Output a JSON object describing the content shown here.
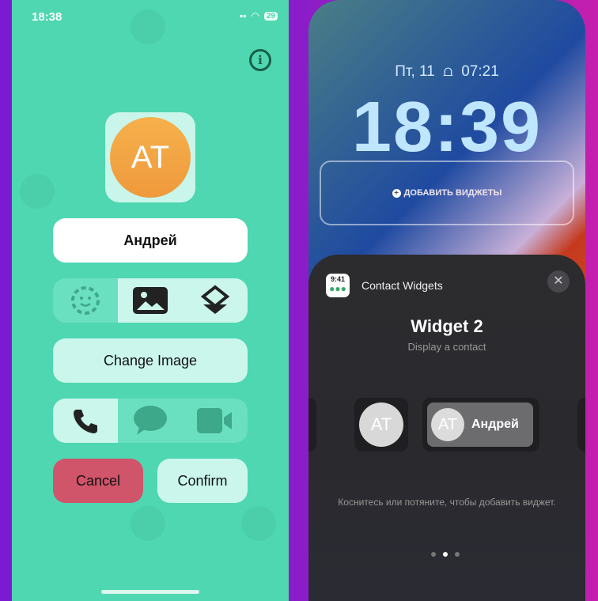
{
  "left_phone": {
    "status": {
      "time": "18:38",
      "battery": "29"
    },
    "avatar_initials": "AT",
    "name_value": "Андрей",
    "image_modes": [
      {
        "icon": "emoji-face-icon",
        "selected": false
      },
      {
        "icon": "photo-icon",
        "selected": true
      },
      {
        "icon": "layers-icon",
        "selected": true
      }
    ],
    "change_image_label": "Change Image",
    "actions": [
      {
        "icon": "phone-icon",
        "selected": true
      },
      {
        "icon": "message-icon",
        "selected": false
      },
      {
        "icon": "video-icon",
        "selected": false
      }
    ],
    "cancel_label": "Cancel",
    "confirm_label": "Confirm",
    "colors": {
      "background": "#4ed7b1",
      "cancel": "#d0546a",
      "accent": "#cbf6ec"
    }
  },
  "right_phone": {
    "date_line": "Пт, 11",
    "sunrise_time": "07:21",
    "clock": "18:39",
    "add_widgets_label": "ДОБАВИТЬ ВИДЖЕТЫ",
    "sheet": {
      "app_icon_time": "9:41",
      "app_name": "Contact Widgets",
      "widget_title": "Widget 2",
      "widget_subtitle": "Display a contact",
      "widget_initials": "AT",
      "widget_name": "Андрей",
      "hint": "Коснитесь или потяните, чтобы добавить виджет.",
      "page_count": 3,
      "active_page": 2
    }
  }
}
